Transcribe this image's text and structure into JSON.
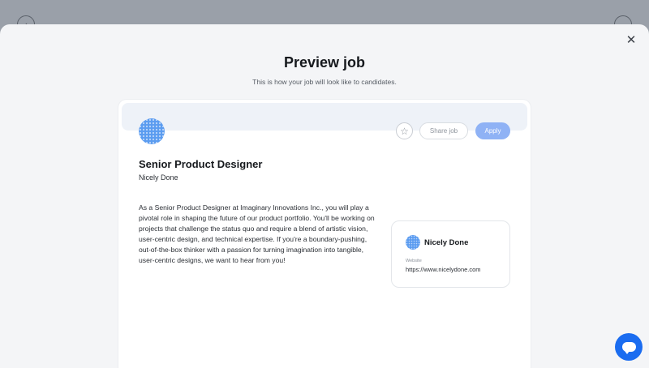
{
  "modal": {
    "title": "Preview job",
    "subtitle": "This is how your job will look like to candidates."
  },
  "job": {
    "title": "Senior Product Designer",
    "company": "Nicely Done",
    "description": "As a Senior Product Designer at Imaginary Innovations Inc., you will play a pivotal role in shaping the future of our product portfolio. You'll be working on projects that challenge the status quo and require a blend of artistic vision, user-centric design, and technical expertise. If you're a boundary-pushing, out-of-the-box thinker with a passion for turning imagination into tangible, user-centric designs, we want to hear from you!"
  },
  "actions": {
    "share_label": "Share job",
    "apply_label": "Apply"
  },
  "company_card": {
    "name": "Nicely Done",
    "website_label": "Website",
    "website_url": "https://www.nicelydone.com"
  },
  "icons": {
    "close": "close-icon",
    "favorite": "star-icon",
    "chat": "chat-icon",
    "back": "chevron-left-icon",
    "forward": "chevron-down-icon"
  },
  "colors": {
    "accent": "#1a6cf0",
    "apply_button": "#8fb2f5",
    "backdrop": "#9aa0a9"
  }
}
